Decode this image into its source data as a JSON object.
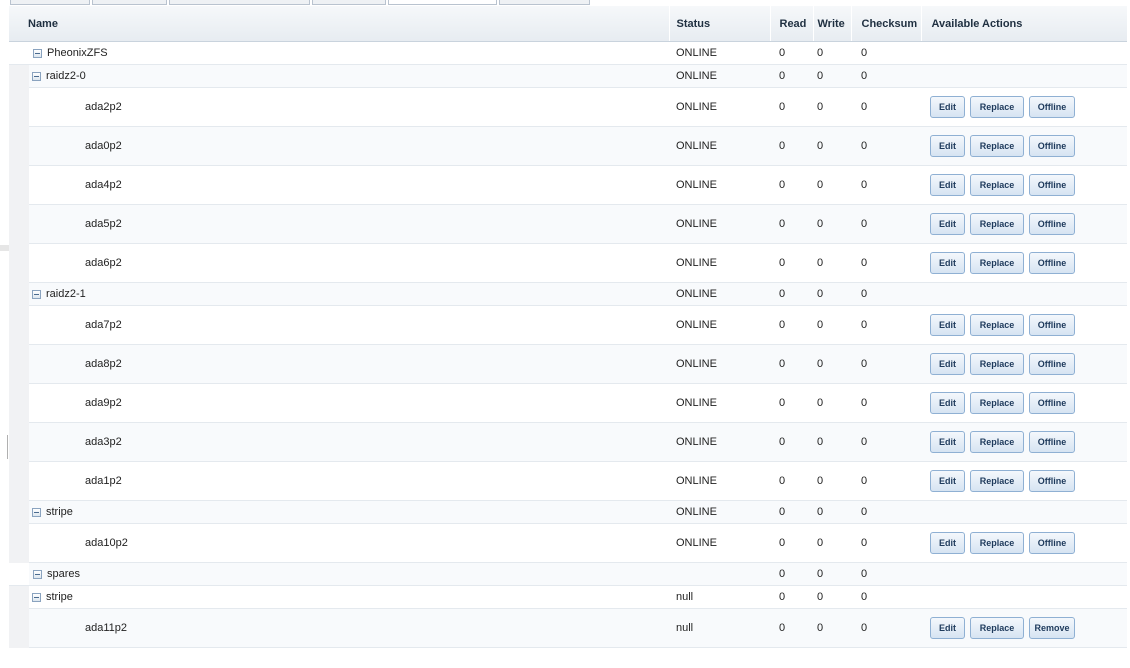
{
  "columns": {
    "name": "Name",
    "status": "Status",
    "read": "Read",
    "write": "Write",
    "checksum": "Checksum",
    "actions": "Available Actions"
  },
  "icons": {
    "toggle": "collapse-minus-icon"
  },
  "colors": {
    "button_border": "#8fb0d3",
    "button_text": "#1e3a5c",
    "header_bg": "#e7ecf1",
    "indent_bg": "#f1f2f4"
  },
  "rows": [
    {
      "level": 0,
      "expandable": true,
      "name": "PheonixZFS",
      "status": "ONLINE",
      "read": "0",
      "write": "0",
      "checksum": "0",
      "actions": []
    },
    {
      "level": 1,
      "expandable": true,
      "name": "raidz2-0",
      "status": "ONLINE",
      "read": "0",
      "write": "0",
      "checksum": "0",
      "actions": []
    },
    {
      "level": 2,
      "expandable": false,
      "name": "ada2p2",
      "status": "ONLINE",
      "read": "0",
      "write": "0",
      "checksum": "0",
      "actions": [
        "Edit",
        "Replace",
        "Offline"
      ]
    },
    {
      "level": 2,
      "expandable": false,
      "name": "ada0p2",
      "status": "ONLINE",
      "read": "0",
      "write": "0",
      "checksum": "0",
      "actions": [
        "Edit",
        "Replace",
        "Offline"
      ]
    },
    {
      "level": 2,
      "expandable": false,
      "name": "ada4p2",
      "status": "ONLINE",
      "read": "0",
      "write": "0",
      "checksum": "0",
      "actions": [
        "Edit",
        "Replace",
        "Offline"
      ]
    },
    {
      "level": 2,
      "expandable": false,
      "name": "ada5p2",
      "status": "ONLINE",
      "read": "0",
      "write": "0",
      "checksum": "0",
      "actions": [
        "Edit",
        "Replace",
        "Offline"
      ]
    },
    {
      "level": 2,
      "expandable": false,
      "name": "ada6p2",
      "status": "ONLINE",
      "read": "0",
      "write": "0",
      "checksum": "0",
      "actions": [
        "Edit",
        "Replace",
        "Offline"
      ]
    },
    {
      "level": 1,
      "expandable": true,
      "name": "raidz2-1",
      "status": "ONLINE",
      "read": "0",
      "write": "0",
      "checksum": "0",
      "actions": []
    },
    {
      "level": 2,
      "expandable": false,
      "name": "ada7p2",
      "status": "ONLINE",
      "read": "0",
      "write": "0",
      "checksum": "0",
      "actions": [
        "Edit",
        "Replace",
        "Offline"
      ]
    },
    {
      "level": 2,
      "expandable": false,
      "name": "ada8p2",
      "status": "ONLINE",
      "read": "0",
      "write": "0",
      "checksum": "0",
      "actions": [
        "Edit",
        "Replace",
        "Offline"
      ]
    },
    {
      "level": 2,
      "expandable": false,
      "name": "ada9p2",
      "status": "ONLINE",
      "read": "0",
      "write": "0",
      "checksum": "0",
      "actions": [
        "Edit",
        "Replace",
        "Offline"
      ]
    },
    {
      "level": 2,
      "expandable": false,
      "name": "ada3p2",
      "status": "ONLINE",
      "read": "0",
      "write": "0",
      "checksum": "0",
      "actions": [
        "Edit",
        "Replace",
        "Offline"
      ]
    },
    {
      "level": 2,
      "expandable": false,
      "name": "ada1p2",
      "status": "ONLINE",
      "read": "0",
      "write": "0",
      "checksum": "0",
      "actions": [
        "Edit",
        "Replace",
        "Offline"
      ]
    },
    {
      "level": 1,
      "expandable": true,
      "name": "stripe",
      "status": "ONLINE",
      "read": "0",
      "write": "0",
      "checksum": "0",
      "actions": []
    },
    {
      "level": 2,
      "expandable": false,
      "name": "ada10p2",
      "status": "ONLINE",
      "read": "0",
      "write": "0",
      "checksum": "0",
      "actions": [
        "Edit",
        "Replace",
        "Offline"
      ]
    },
    {
      "level": 0,
      "expandable": true,
      "name": "spares",
      "status": "",
      "read": "0",
      "write": "0",
      "checksum": "0",
      "actions": []
    },
    {
      "level": 1,
      "expandable": true,
      "name": "stripe",
      "status": "null",
      "read": "0",
      "write": "0",
      "checksum": "0",
      "actions": []
    },
    {
      "level": 2,
      "expandable": false,
      "name": "ada11p2",
      "status": "null",
      "read": "0",
      "write": "0",
      "checksum": "0",
      "actions": [
        "Edit",
        "Replace",
        "Remove"
      ]
    }
  ]
}
